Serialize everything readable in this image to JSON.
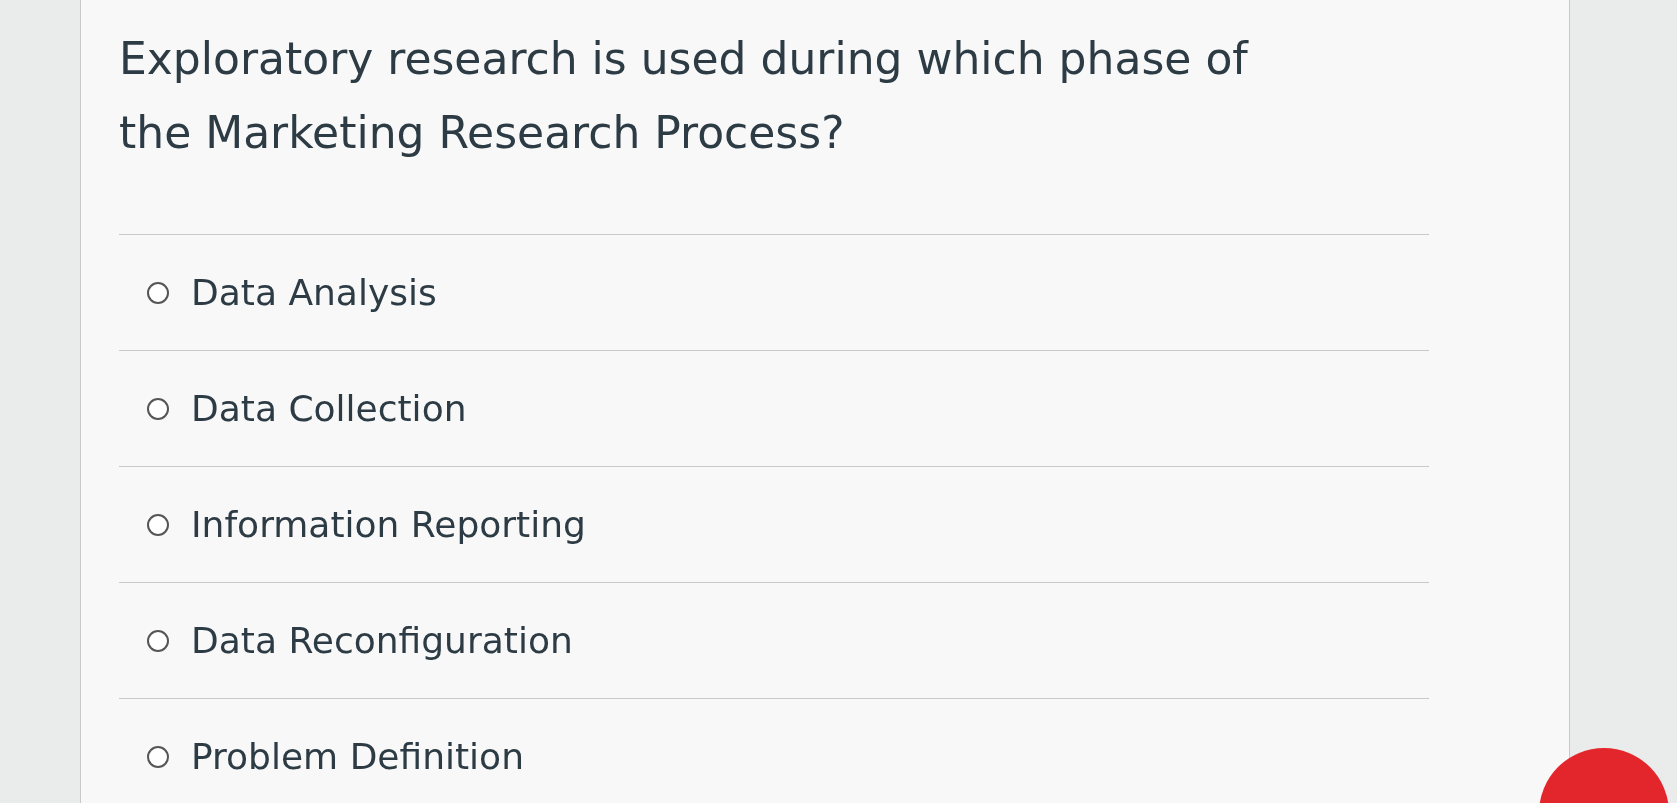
{
  "question": "Exploratory research is used during which phase of the Marketing Research Process?",
  "options": [
    {
      "label": "Data Analysis",
      "selected": false
    },
    {
      "label": "Data Collection",
      "selected": false
    },
    {
      "label": "Information Reporting",
      "selected": false
    },
    {
      "label": "Data Reconfiguration",
      "selected": false
    },
    {
      "label": "Problem Definition",
      "selected": false
    }
  ]
}
